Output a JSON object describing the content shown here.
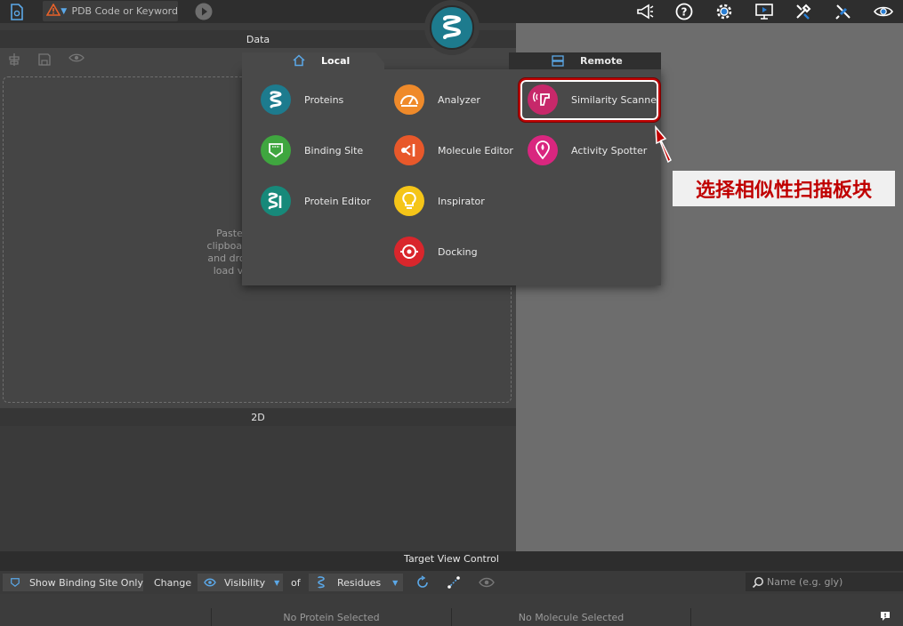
{
  "topbar": {
    "search_placeholder": "PDB Code or Keyword",
    "icons": [
      "file-icon",
      "warning-icon",
      "play-icon",
      "megaphone-icon",
      "help-icon",
      "settings-icon",
      "monitor-icon",
      "tools-icon",
      "satellite-icon",
      "eye-icon"
    ]
  },
  "data_panel": {
    "title": "Data",
    "drop_text": "Paste\nclipboard\nand drop\nload vi"
  },
  "panel_2d": {
    "title": "2D"
  },
  "popup": {
    "tab_local": "Local",
    "tab_remote": "Remote",
    "apps": [
      {
        "label": "Proteins",
        "color": "#1d7b8e"
      },
      {
        "label": "Binding Site",
        "color": "#3fa63f"
      },
      {
        "label": "Protein Editor",
        "color": "#17897a"
      },
      {
        "label": "Analyzer",
        "color": "#ef8a2a"
      },
      {
        "label": "Molecule Editor",
        "color": "#e8582a"
      },
      {
        "label": "Inspirator",
        "color": "#f5c518"
      },
      {
        "label": "Docking",
        "color": "#d9262c"
      },
      {
        "label": "Similarity Scanner",
        "color": "#c7286a"
      },
      {
        "label": "Activity Spotter",
        "color": "#d9267f"
      }
    ]
  },
  "annotation": {
    "callout": "选择相似性扫描板块",
    "color": "#c00000"
  },
  "target_view_control": {
    "title": "Target View Control",
    "show_binding_site_only": "Show Binding Site Only",
    "change": "Change",
    "visibility": "Visibility",
    "of": "of",
    "residues": "Residues",
    "name_placeholder": "Name (e.g. gly)"
  },
  "status": {
    "protein": "No Protein Selected",
    "molecule": "No Molecule Selected"
  }
}
